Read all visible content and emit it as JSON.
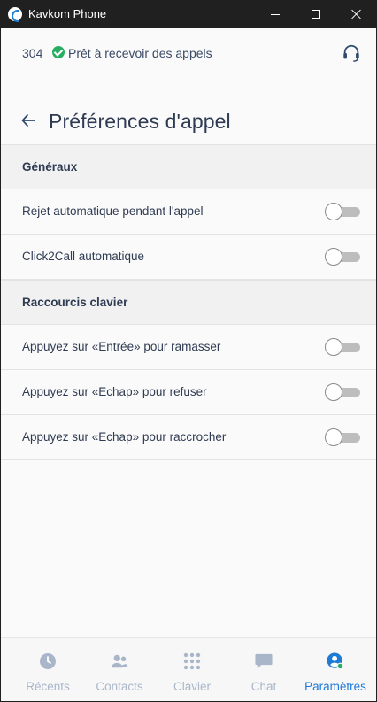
{
  "window": {
    "title": "Kavkom Phone"
  },
  "status": {
    "extension": "304",
    "text": "Prêt à recevoir des appels",
    "status_color": "#27ae60"
  },
  "page": {
    "title": "Préférences d'appel"
  },
  "sections": [
    {
      "title": "Généraux",
      "options": [
        {
          "label": "Rejet automatique pendant l'appel",
          "enabled": false
        },
        {
          "label": "Click2Call automatique",
          "enabled": false
        }
      ]
    },
    {
      "title": "Raccourcis clavier",
      "options": [
        {
          "label": "Appuyez sur «Entrée» pour ramasser",
          "enabled": false
        },
        {
          "label": "Appuyez sur «Echap» pour refuser",
          "enabled": false
        },
        {
          "label": "Appuyez sur «Echap» pour raccrocher",
          "enabled": false
        }
      ]
    }
  ],
  "nav": {
    "items": [
      {
        "label": "Récents",
        "icon": "clock-icon",
        "active": false
      },
      {
        "label": "Contacts",
        "icon": "contacts-icon",
        "active": false
      },
      {
        "label": "Clavier",
        "icon": "dialpad-icon",
        "active": false
      },
      {
        "label": "Chat",
        "icon": "chat-icon",
        "active": false
      },
      {
        "label": "Paramètres",
        "icon": "user-settings-icon",
        "active": true
      }
    ]
  },
  "colors": {
    "accent": "#1f7ad6",
    "text": "#2f3b52",
    "nav_inactive": "#a9b6c9"
  }
}
